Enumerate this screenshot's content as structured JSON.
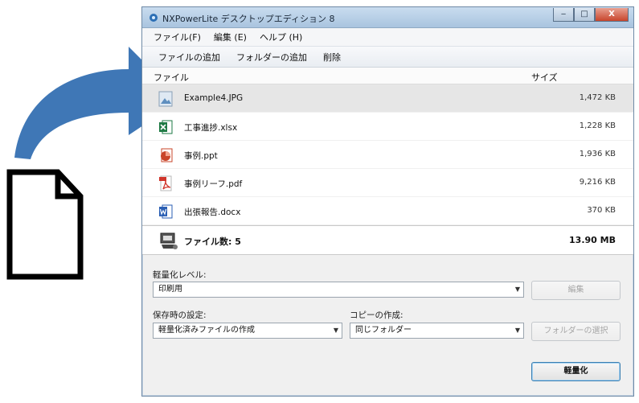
{
  "window": {
    "title": "NXPowerLite デスクトップエディション 8",
    "controls": {
      "minimize": "‒",
      "maximize": "□",
      "close": "X"
    }
  },
  "menu": [
    "ファイル(F)",
    "編集 (E)",
    "ヘルプ (H)"
  ],
  "toolbar": [
    "ファイルの追加",
    "フォルダーの追加",
    "削除"
  ],
  "list": {
    "columns": {
      "file": "ファイル",
      "size": "サイズ"
    },
    "rows": [
      {
        "name": "Example4.JPG",
        "size": "1,472 KB",
        "icon": "jpg-icon",
        "selected": true
      },
      {
        "name": "工事進捗.xlsx",
        "size": "1,228 KB",
        "icon": "excel-icon"
      },
      {
        "name": "事例.ppt",
        "size": "1,936 KB",
        "icon": "powerpoint-icon"
      },
      {
        "name": "事例リーフ.pdf",
        "size": "9,216 KB",
        "icon": "pdf-icon"
      },
      {
        "name": "出張報告.docx",
        "size": "370 KB",
        "icon": "word-icon"
      }
    ],
    "summary": {
      "count": "ファイル数: 5",
      "total": "13.90 MB"
    }
  },
  "settings": {
    "level_label": "軽量化レベル:",
    "level_value": "印刷用",
    "edit_button": "編集",
    "save_label": "保存時の設定:",
    "save_value": "軽量化済みファイルの作成",
    "copy_label": "コピーの作成:",
    "copy_value": "同じフォルダー",
    "folder_button": "フォルダーの選択",
    "run_button": "軽量化"
  },
  "colors": {
    "arrow": "#3f77b6",
    "excel": "#1e7a44",
    "powerpoint": "#c9452a",
    "pdf": "#d0352b",
    "word": "#2b5fb4"
  }
}
